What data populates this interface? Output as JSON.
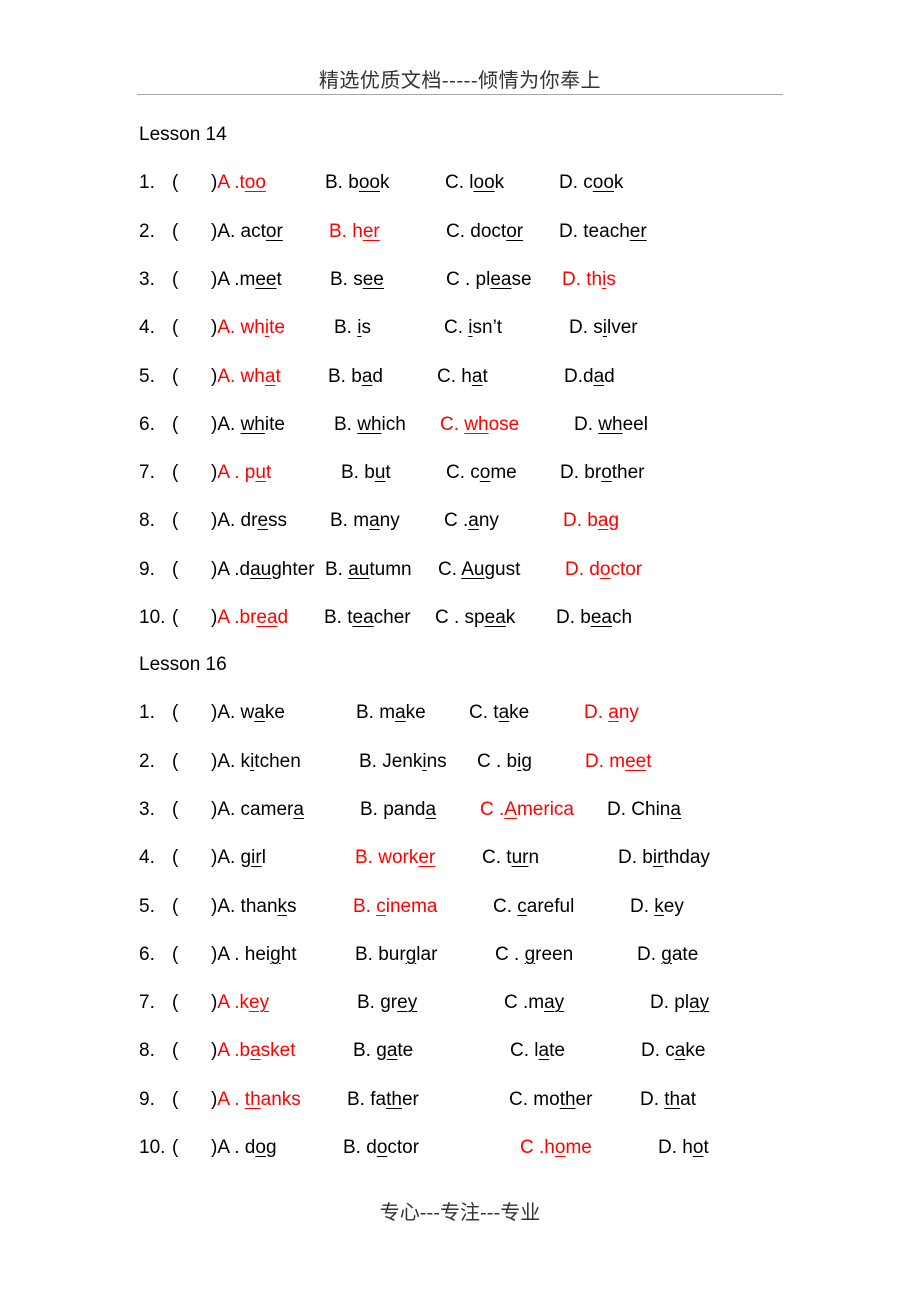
{
  "header": "精选优质文档-----倾情为你奉上",
  "footer": "专心---专注---专业",
  "colors": {
    "correct": "#ff0000",
    "text": "#000000"
  },
  "lessons": [
    {
      "title": "Lesson 14",
      "questions": [
        {
          "num": "1.",
          "paren": "(",
          "options": [
            {
              "pre": "A .t",
              "u": "oo",
              "post": "",
              "correct": true
            },
            {
              "pre": "B. b",
              "u": "oo",
              "post": "k",
              "correct": false
            },
            {
              "pre": "C. l",
              "u": "oo",
              "post": "k",
              "correct": false
            },
            {
              "pre": "D. c",
              "u": "oo",
              "post": "k",
              "correct": false
            }
          ]
        },
        {
          "num": "2.",
          "paren": "(",
          "options": [
            {
              "pre": "A. act",
              "u": "or",
              "post": "",
              "correct": false
            },
            {
              "pre": "B. h",
              "u": "er",
              "post": "",
              "correct": true
            },
            {
              "pre": "C. doct",
              "u": "or",
              "post": "",
              "correct": false
            },
            {
              "pre": "D. teach",
              "u": "er",
              "post": "",
              "correct": false
            }
          ]
        },
        {
          "num": "3.",
          "paren": "(",
          "options": [
            {
              "pre": "A .m",
              "u": "ee",
              "post": "t",
              "correct": false
            },
            {
              "pre": "B. s",
              "u": "ee",
              "post": "",
              "correct": false
            },
            {
              "pre": "C . pl",
              "u": "ea",
              "post": "se",
              "correct": false
            },
            {
              "pre": "D. th",
              "u": "i",
              "post": "s",
              "correct": true
            }
          ]
        },
        {
          "num": "4.",
          "paren": "(",
          "options": [
            {
              "pre": "A. wh",
              "u": "i",
              "post": "te",
              "correct": true
            },
            {
              "pre": "B. ",
              "u": "i",
              "post": "s",
              "correct": false
            },
            {
              "pre": "C. ",
              "u": "i",
              "post": "sn’t",
              "correct": false
            },
            {
              "pre": "D. s",
              "u": "i",
              "post": "lver",
              "correct": false
            }
          ]
        },
        {
          "num": "5.",
          "paren": "(",
          "options": [
            {
              "pre": "A. wh",
              "u": "a",
              "post": "t",
              "correct": true
            },
            {
              "pre": "B. b",
              "u": "a",
              "post": "d",
              "correct": false
            },
            {
              "pre": "C. h",
              "u": "a",
              "post": "t",
              "correct": false
            },
            {
              "pre": "D.d",
              "u": "a",
              "post": "d",
              "correct": false
            }
          ]
        },
        {
          "num": "6.",
          "paren": "(",
          "options": [
            {
              "pre": "A. ",
              "u": "wh",
              "post": "ite",
              "correct": false
            },
            {
              "pre": "B. ",
              "u": "wh",
              "post": "ich",
              "correct": false
            },
            {
              "pre": "C. ",
              "u": "wh",
              "post": "ose",
              "correct": true
            },
            {
              "pre": "D. ",
              "u": "wh",
              "post": "eel",
              "correct": false
            }
          ]
        },
        {
          "num": "7.",
          "paren": "(",
          "options": [
            {
              "pre": "A . p",
              "u": "u",
              "post": "t",
              "correct": true
            },
            {
              "pre": "B. b",
              "u": "u",
              "post": "t",
              "correct": false
            },
            {
              "pre": "C. c",
              "u": "o",
              "post": "me",
              "correct": false
            },
            {
              "pre": "D. br",
              "u": "o",
              "post": "ther",
              "correct": false
            }
          ]
        },
        {
          "num": "8.",
          "paren": "(",
          "options": [
            {
              "pre": "A. dr",
              "u": "e",
              "post": "ss",
              "correct": false
            },
            {
              "pre": "B. m",
              "u": "a",
              "post": "ny",
              "correct": false
            },
            {
              "pre": "C .",
              "u": "a",
              "post": "ny",
              "correct": false
            },
            {
              "pre": "D. b",
              "u": "a",
              "post": "g",
              "correct": true
            }
          ]
        },
        {
          "num": "9.",
          "paren": "(",
          "options": [
            {
              "pre": "A .d",
              "u": "au",
              "post": "ghter",
              "correct": false
            },
            {
              "pre": "B. ",
              "u": "au",
              "post": "tumn",
              "correct": false
            },
            {
              "pre": "C. ",
              "u": "Au",
              "post": "gust",
              "correct": false
            },
            {
              "pre": "D. d",
              "u": "o",
              "post": "ctor",
              "correct": true
            }
          ]
        },
        {
          "num": "10.",
          "paren": "(",
          "options": [
            {
              "pre": "A .br",
              "u": "ea",
              "post": "d",
              "correct": true
            },
            {
              "pre": "B. t",
              "u": "ea",
              "post": "cher",
              "correct": false
            },
            {
              "pre": "C . sp",
              "u": "ea",
              "post": "k",
              "correct": false
            },
            {
              "pre": "D. b",
              "u": "ea",
              "post": "ch",
              "correct": false
            }
          ]
        }
      ]
    },
    {
      "title": "Lesson 16",
      "questions": [
        {
          "num": "1.",
          "paren": "(",
          "options": [
            {
              "pre": "A. w",
              "u": "a",
              "post": "ke",
              "correct": false
            },
            {
              "pre": "B. m",
              "u": "a",
              "post": "ke",
              "correct": false
            },
            {
              "pre": "C. t",
              "u": "a",
              "post": "ke",
              "correct": false
            },
            {
              "pre": "D. ",
              "u": "a",
              "post": "ny",
              "correct": true
            }
          ]
        },
        {
          "num": "2.",
          "paren": "(",
          "options": [
            {
              "pre": "A. k",
              "u": "i",
              "post": "tchen",
              "correct": false
            },
            {
              "pre": "B. Jenk",
              "u": "i",
              "post": "ns",
              "correct": false
            },
            {
              "pre": "C . b",
              "u": "i",
              "post": "g",
              "correct": false
            },
            {
              "pre": "D. m",
              "u": "ee",
              "post": "t",
              "correct": true
            }
          ]
        },
        {
          "num": "3.",
          "paren": "(",
          "options": [
            {
              "pre": "A. camer",
              "u": "a",
              "post": "",
              "correct": false
            },
            {
              "pre": "B. pand",
              "u": "a",
              "post": "",
              "correct": false
            },
            {
              "pre": "C .",
              "u": "A",
              "post": "merica",
              "correct": true
            },
            {
              "pre": "D. Chin",
              "u": "a",
              "post": "",
              "correct": false
            }
          ]
        },
        {
          "num": "4.",
          "paren": "(",
          "options": [
            {
              "pre": "A. g",
              "u": "ir",
              "post": "l",
              "correct": false
            },
            {
              "pre": "B. work",
              "u": "er",
              "post": "",
              "correct": true
            },
            {
              "pre": "C. t",
              "u": "ur",
              "post": "n",
              "correct": false
            },
            {
              "pre": "D. b",
              "u": "ir",
              "post": "thday",
              "correct": false
            }
          ]
        },
        {
          "num": "5.",
          "paren": "(",
          "options": [
            {
              "pre": "A. than",
              "u": "k",
              "post": "s",
              "correct": false
            },
            {
              "pre": "B. ",
              "u": "c",
              "post": "inema",
              "correct": true
            },
            {
              "pre": "C. ",
              "u": "c",
              "post": "areful",
              "correct": false
            },
            {
              "pre": "D. ",
              "u": "k",
              "post": "ey",
              "correct": false
            }
          ]
        },
        {
          "num": "6.",
          "paren": "(",
          "options": [
            {
              "pre": "A . hei",
              "u": "g",
              "post": "ht",
              "correct": false
            },
            {
              "pre": "B. bur",
              "u": "g",
              "post": "lar",
              "correct": false
            },
            {
              "pre": "C . ",
              "u": "g",
              "post": "reen",
              "correct": false
            },
            {
              "pre": "D. ",
              "u": "g",
              "post": "ate",
              "correct": false
            }
          ]
        },
        {
          "num": "7.",
          "paren": "(",
          "options": [
            {
              "pre": "A .k",
              "u": "ey",
              "post": "",
              "correct": true
            },
            {
              "pre": "B. gr",
              "u": "ey",
              "post": "",
              "correct": false
            },
            {
              "pre": "C .m",
              "u": "ay",
              "post": "",
              "correct": false
            },
            {
              "pre": "D. pl",
              "u": "ay",
              "post": "",
              "correct": false
            }
          ]
        },
        {
          "num": "8.",
          "paren": "(",
          "options": [
            {
              "pre": "A .b",
              "u": "a",
              "post": "sket",
              "correct": true
            },
            {
              "pre": "B. g",
              "u": "a",
              "post": "te",
              "correct": false
            },
            {
              "pre": "C. l",
              "u": "a",
              "post": "te",
              "correct": false
            },
            {
              "pre": "D. c",
              "u": "a",
              "post": "ke",
              "correct": false
            }
          ]
        },
        {
          "num": "9.",
          "paren": "(",
          "options": [
            {
              "pre": "A . ",
              "u": "th",
              "post": "anks",
              "correct": true
            },
            {
              "pre": "B. fa",
              "u": "th",
              "post": "er",
              "correct": false
            },
            {
              "pre": "C. mo",
              "u": "th",
              "post": "er",
              "correct": false
            },
            {
              "pre": "D. ",
              "u": "th",
              "post": "at",
              "correct": false
            }
          ]
        },
        {
          "num": "10.",
          "paren": "(",
          "options": [
            {
              "pre": "A . d",
              "u": "o",
              "post": "g",
              "correct": false
            },
            {
              "pre": "B. d",
              "u": "o",
              "post": "ctor",
              "correct": false
            },
            {
              "pre": "C .h",
              "u": "o",
              "post": "me",
              "correct": true
            },
            {
              "pre": "D. h",
              "u": "o",
              "post": "t",
              "correct": false
            }
          ]
        }
      ]
    }
  ]
}
